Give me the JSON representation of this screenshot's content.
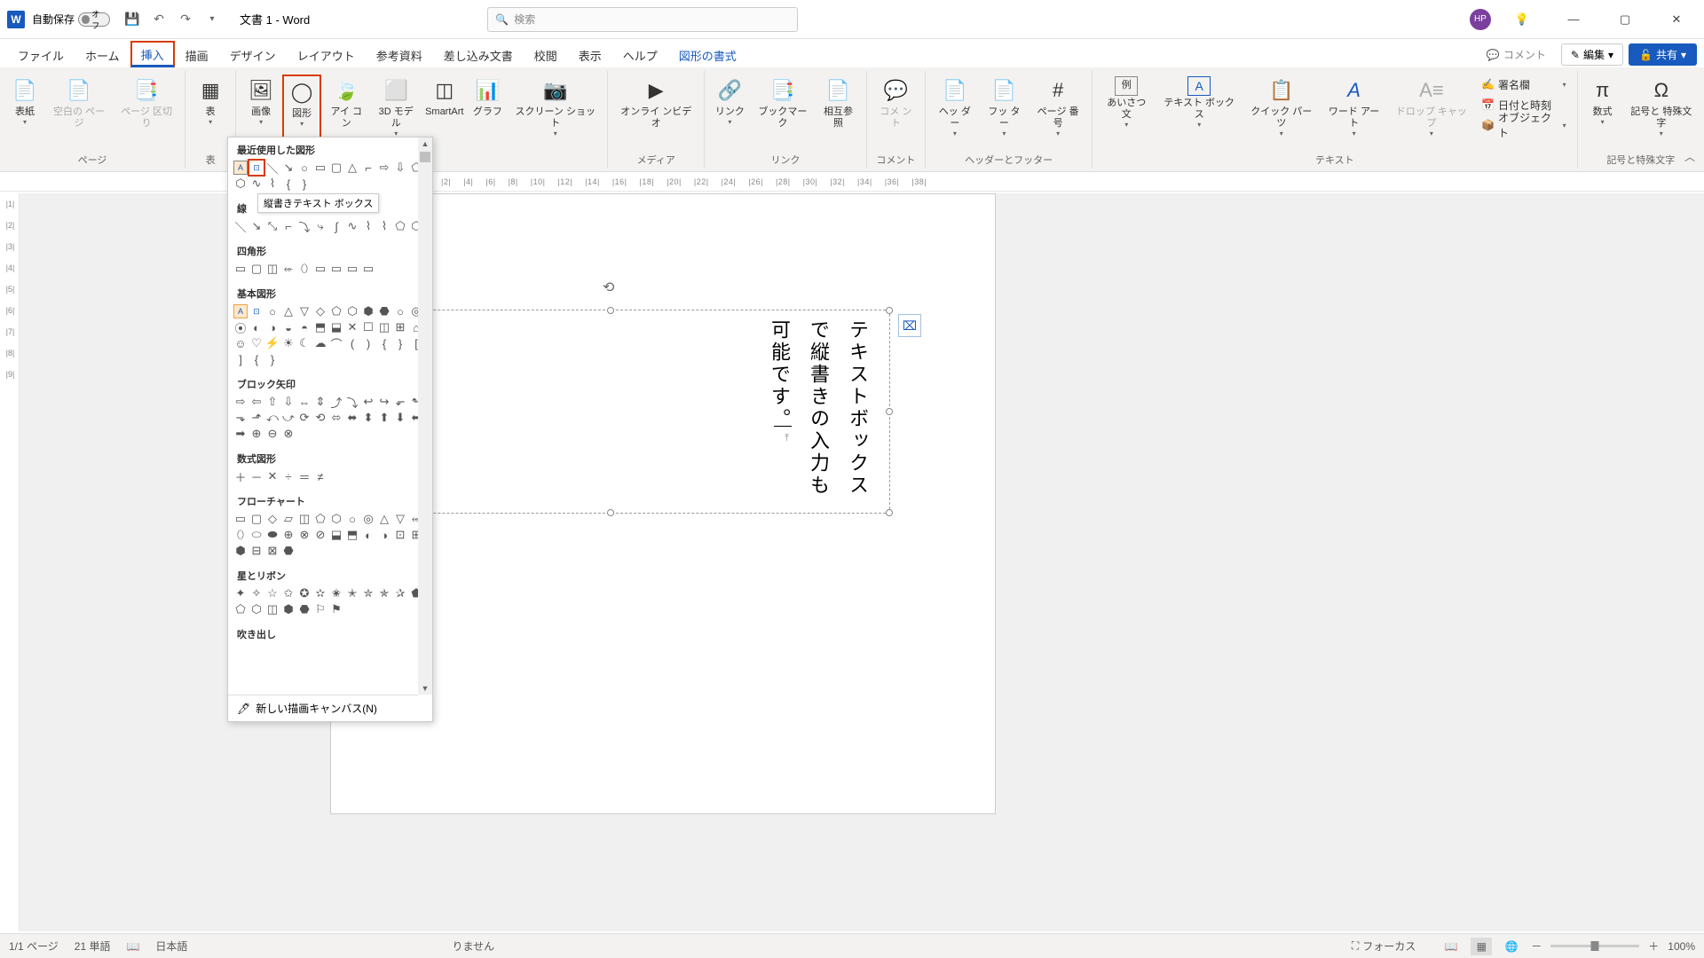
{
  "titlebar": {
    "autosave_label": "自動保存",
    "autosave_state": "オフ",
    "doc_title": "文書 1  -  Word",
    "search_placeholder": "検索",
    "avatar_initials": "HP"
  },
  "tabs": {
    "file": "ファイル",
    "home": "ホーム",
    "insert": "挿入",
    "draw": "描画",
    "design": "デザイン",
    "layout": "レイアウト",
    "references": "参考資料",
    "mailings": "差し込み文書",
    "review": "校閲",
    "view": "表示",
    "help": "ヘルプ",
    "shape_format": "図形の書式",
    "comment_btn": "コメント",
    "edit_btn": "編集",
    "share_btn": "共有"
  },
  "ribbon": {
    "groups": {
      "page": "ページ",
      "table": "表",
      "media": "メディア",
      "link": "リンク",
      "comment": "コメント",
      "header_footer": "ヘッダーとフッター",
      "text": "テキスト",
      "symbols": "記号と特殊文字"
    },
    "buttons": {
      "cover_page": "表紙",
      "blank_page": "空白の\nページ",
      "page_break": "ページ\n区切り",
      "table": "表",
      "pictures": "画像",
      "shapes": "図形",
      "icons": "アイ\nコン",
      "models_3d": "3D\nモデル",
      "smartart": "SmartArt",
      "chart": "グラフ",
      "screenshot": "スクリーン\nショット",
      "online_video": "オンライ\nンビデオ",
      "link": "リンク",
      "bookmark": "ブックマーク",
      "cross_ref": "相互参照",
      "comment": "コメ\nント",
      "header": "ヘッ\nダー",
      "footer": "フッ\nター",
      "page_number": "ページ\n番号",
      "greeting": "あいさつ\n文",
      "textbox": "テキスト\nボックス",
      "quick_parts": "クイック パーツ",
      "wordart": "ワード\nアート",
      "drop_cap": "ドロップ\nキャップ",
      "signature": "署名欄",
      "date_time": "日付と時刻",
      "object": "オブジェクト",
      "equation": "数式",
      "symbol": "記号と\n特殊文字"
    }
  },
  "ruler_h": [
    "|2|",
    "|4|",
    "|6|",
    "|8|",
    "|10|",
    "|12|",
    "|14|",
    "|16|",
    "|18|",
    "|20|",
    "|22|",
    "|24|",
    "|26|",
    "|28|",
    "|30|",
    "|32|",
    "|34|",
    "|36|",
    "|38|"
  ],
  "ruler_v": [
    "",
    "",
    "|1|",
    "|2|",
    "|3|",
    "|4|",
    "|5|",
    "|6|",
    "|7|",
    "|8|",
    "|9|"
  ],
  "shapes_panel": {
    "sections": {
      "recent": "最近使用した図形",
      "lines": "線",
      "rectangles": "四角形",
      "basic": "基本図形",
      "block_arrows": "ブロック矢印",
      "equation": "数式図形",
      "flowchart": "フローチャート",
      "stars": "星とリボン",
      "callouts": "吹き出し"
    },
    "tooltip": "縦書きテキスト ボックス",
    "new_canvas": "新しい描画キャンバス(N)"
  },
  "textbox_content": "テキストボックスで縦書きの入力も可能です。",
  "statusbar": {
    "page": "1/1 ページ",
    "words": "21 単語",
    "lang": "日本語",
    "accessibility": "りません",
    "focus": "フォーカス",
    "zoom": "100%"
  }
}
